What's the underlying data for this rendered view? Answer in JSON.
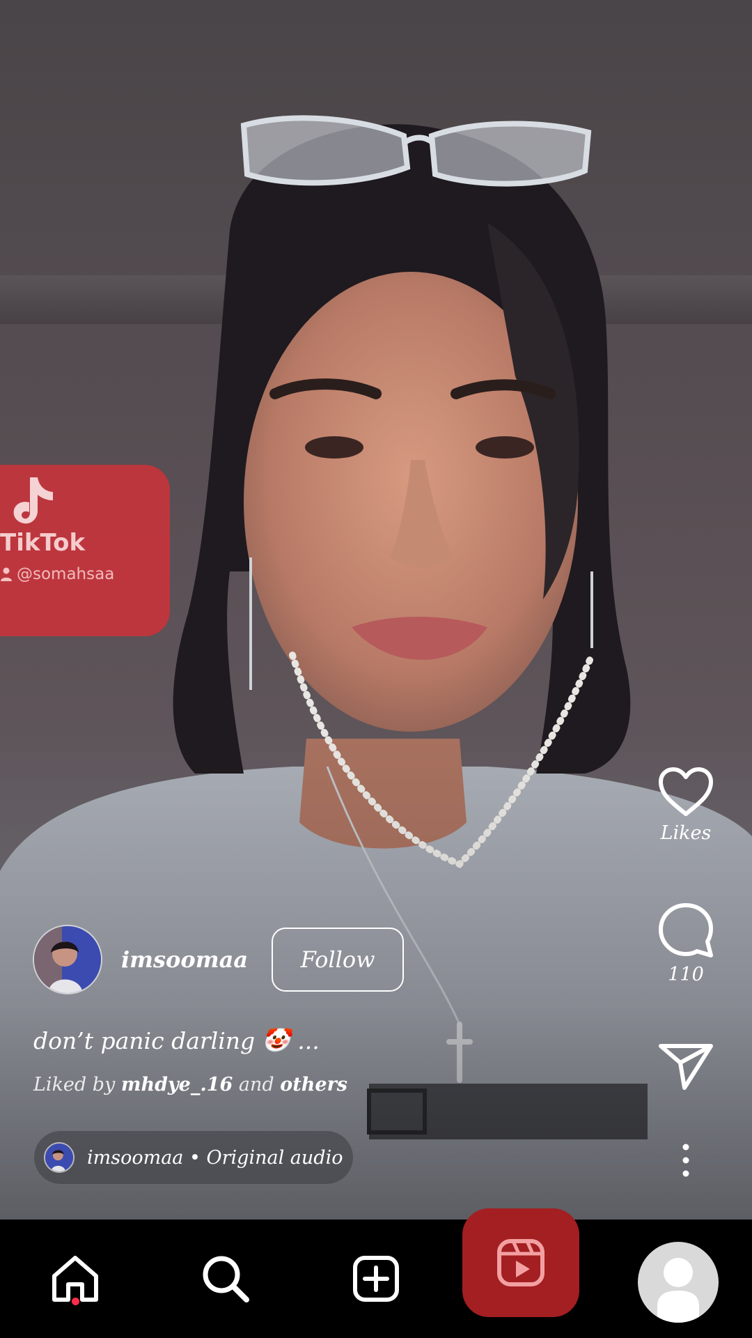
{
  "watermark": {
    "brand": "TikTok",
    "handle": "@somahsaa"
  },
  "actions": {
    "likes_label": "Likes",
    "comments_count": "110"
  },
  "creator": {
    "username": "imsoomaa",
    "follow_label": "Follow"
  },
  "caption": {
    "text": "don’t panic darling",
    "emoji": "🤡",
    "more": "..."
  },
  "liked_by": {
    "prefix": "Liked by",
    "user": "mhdye_.16",
    "connector": "and",
    "others": "others"
  },
  "audio": {
    "text": "imsoomaa • Original audio"
  },
  "nav": {
    "items": [
      "home-icon",
      "search-icon",
      "create-icon",
      "reels-icon",
      "profile-icon"
    ],
    "active": "reels-icon"
  },
  "colors": {
    "watermark_red": "#cd323a",
    "reels_active": "#a31f22",
    "notification_dot": "#ff2d4b"
  }
}
